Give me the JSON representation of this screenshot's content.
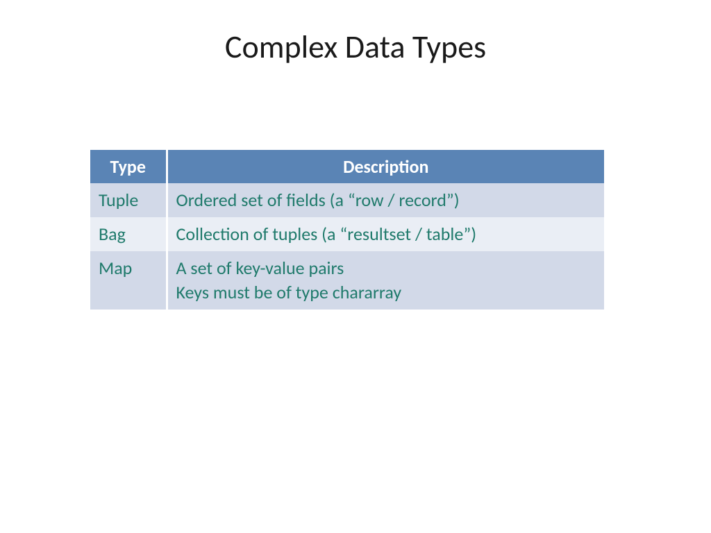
{
  "slide": {
    "title": "Complex Data Types",
    "table": {
      "headers": {
        "type": "Type",
        "description": "Description"
      },
      "rows": [
        {
          "type": "Tuple",
          "description": "Ordered set of fields (a “row / record”)"
        },
        {
          "type": "Bag",
          "description": "Collection of tuples (a “resultset / table”)"
        },
        {
          "type": "Map",
          "description": "A set of key-value pairs\nKeys must be of type chararray"
        }
      ]
    }
  }
}
